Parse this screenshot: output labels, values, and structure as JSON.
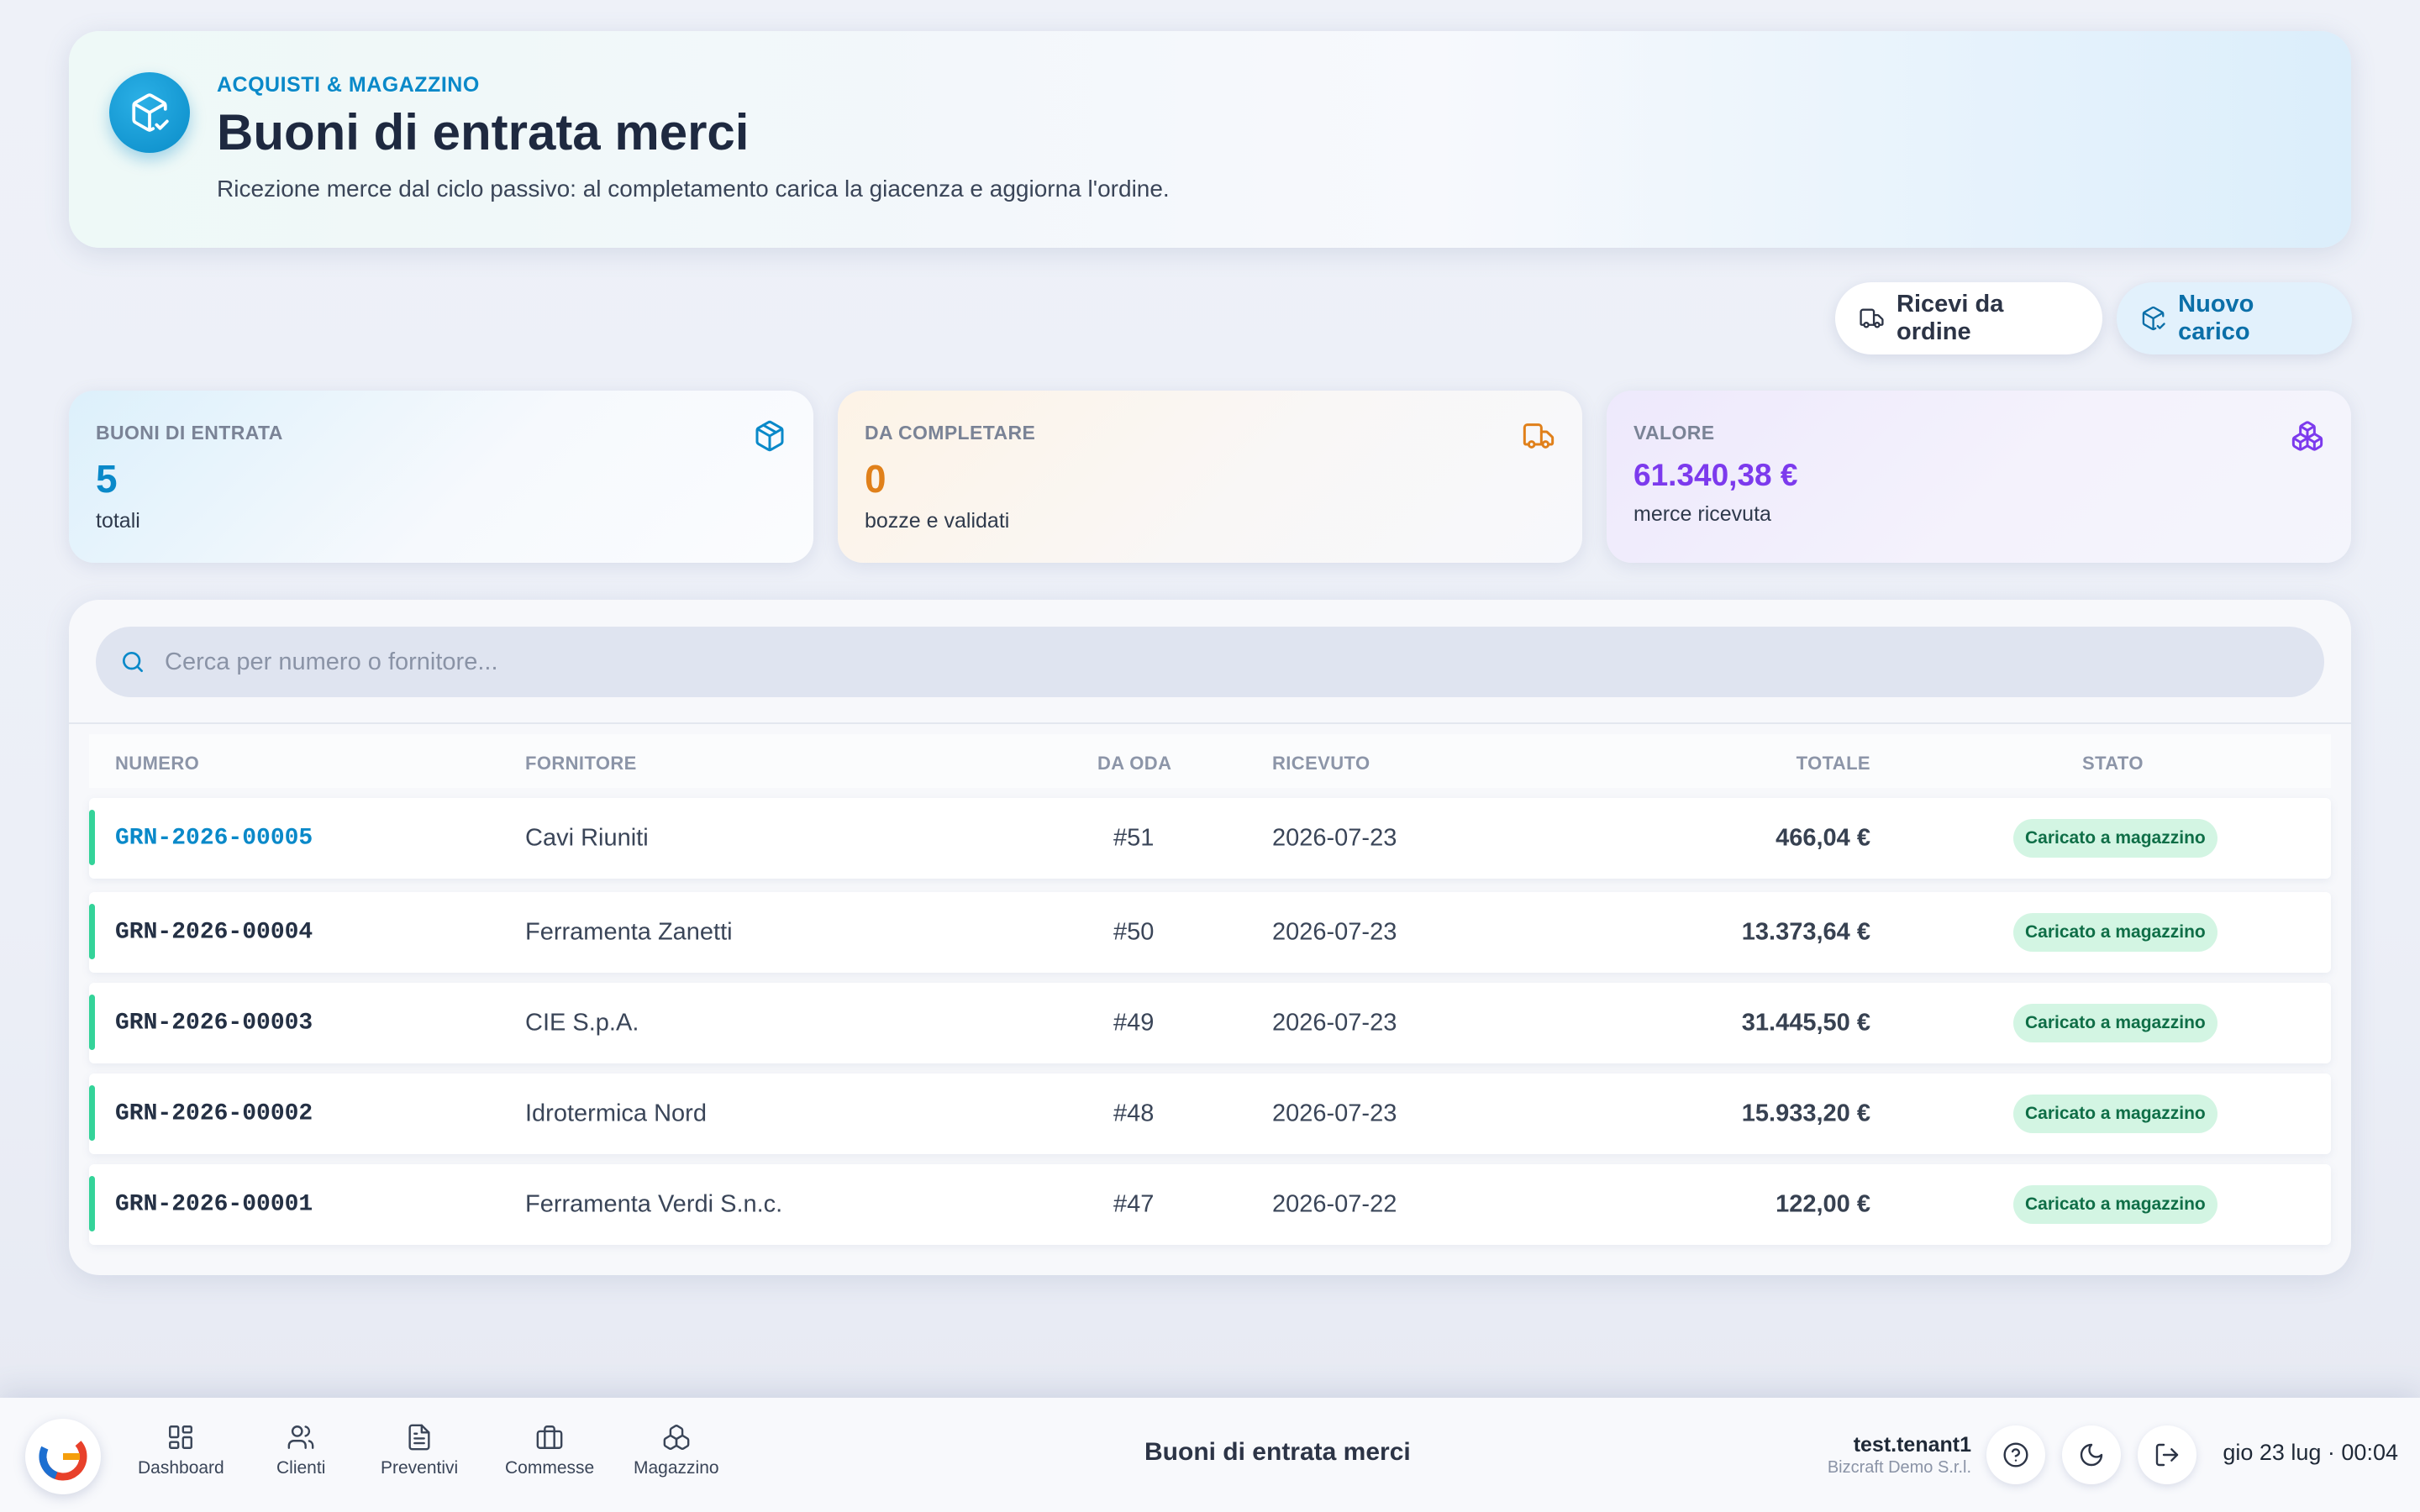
{
  "header": {
    "eyebrow": "ACQUISTI & MAGAZZINO",
    "title": "Buoni di entrata merci",
    "subtitle": "Ricezione merce dal ciclo passivo: al completamento carica la giacenza e aggiorna l'ordine.",
    "icon": "package-check-icon"
  },
  "actions": {
    "receive_label": "Ricevi da ordine",
    "new_label": "Nuovo carico"
  },
  "stats": [
    {
      "label": "BUONI DI ENTRATA",
      "value": "5",
      "note": "totali",
      "color": "#0a89c9",
      "icon": "package-icon"
    },
    {
      "label": "DA COMPLETARE",
      "value": "0",
      "note": "bozze e validati",
      "color": "#e0801a",
      "icon": "truck-icon"
    },
    {
      "label": "VALORE",
      "value": "61.340,38 €",
      "note": "merce ricevuta",
      "color": "#7c3aed",
      "icon": "boxes-icon"
    }
  ],
  "search": {
    "placeholder": "Cerca per numero o fornitore..."
  },
  "table": {
    "columns": [
      "NUMERO",
      "FORNITORE",
      "DA ODA",
      "RICEVUTO",
      "TOTALE",
      "STATO"
    ],
    "rows": [
      {
        "numero": "GRN-2026-00005",
        "fornitore": "Cavi Riuniti",
        "oda": "#51",
        "ricevuto": "2026-07-23",
        "totale": "466,04 €",
        "stato": "Caricato a magazzino"
      },
      {
        "numero": "GRN-2026-00004",
        "fornitore": "Ferramenta Zanetti",
        "oda": "#50",
        "ricevuto": "2026-07-23",
        "totale": "13.373,64 €",
        "stato": "Caricato a magazzino"
      },
      {
        "numero": "GRN-2026-00003",
        "fornitore": "CIE S.p.A.",
        "oda": "#49",
        "ricevuto": "2026-07-23",
        "totale": "31.445,50 €",
        "stato": "Caricato a magazzino"
      },
      {
        "numero": "GRN-2026-00002",
        "fornitore": "Idrotermica Nord",
        "oda": "#48",
        "ricevuto": "2026-07-23",
        "totale": "15.933,20 €",
        "stato": "Caricato a magazzino"
      },
      {
        "numero": "GRN-2026-00001",
        "fornitore": "Ferramenta Verdi S.n.c.",
        "oda": "#47",
        "ricevuto": "2026-07-22",
        "totale": "122,00 €",
        "stato": "Caricato a magazzino"
      }
    ]
  },
  "bottom_nav": {
    "items": [
      {
        "label": "Dashboard",
        "icon": "dashboard-icon"
      },
      {
        "label": "Clienti",
        "icon": "users-icon"
      },
      {
        "label": "Preventivi",
        "icon": "document-icon"
      },
      {
        "label": "Commesse",
        "icon": "briefcase-icon"
      },
      {
        "label": "Magazzino",
        "icon": "boxes-icon"
      }
    ],
    "page_title": "Buoni di entrata merci",
    "user": "test.tenant1",
    "org": "Bizcraft Demo S.r.l.",
    "clock": "gio 23 lug · 00:04"
  },
  "colors": {
    "accent": "#0a89c9",
    "success": "#34d399",
    "warning": "#e0801a",
    "violet": "#7c3aed"
  }
}
